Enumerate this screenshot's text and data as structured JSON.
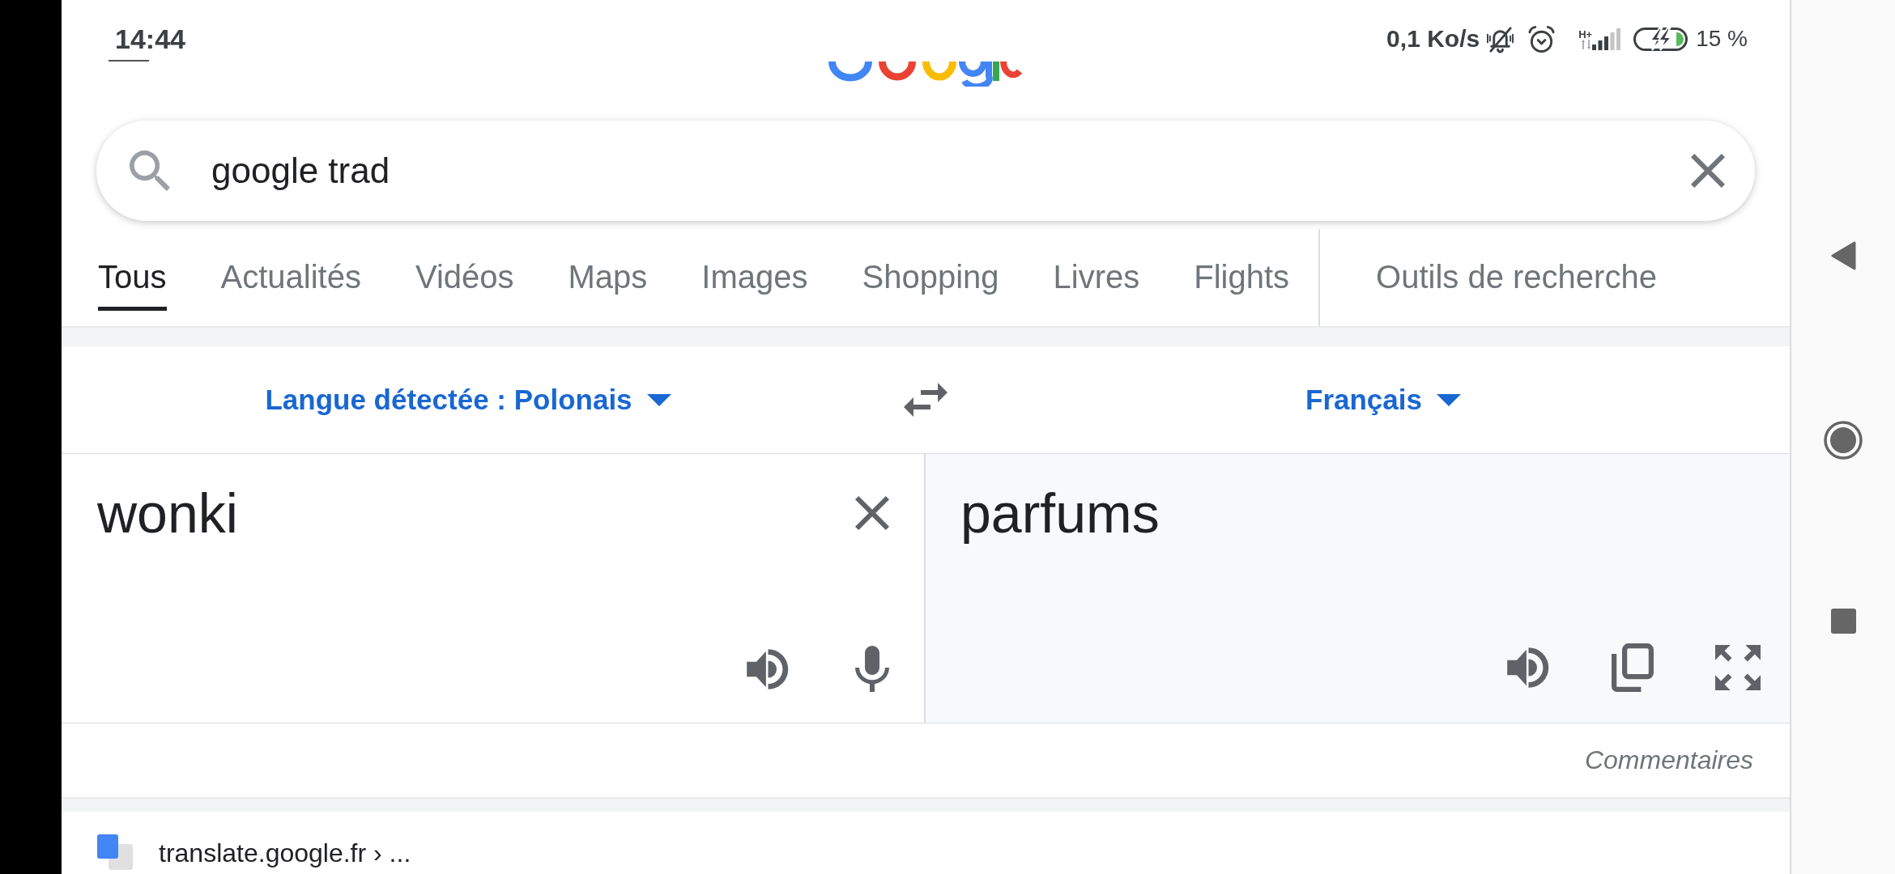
{
  "status_bar": {
    "time": "14:44",
    "network_speed": "0,1 Ko/s",
    "network_type": "H+",
    "battery": "15 %"
  },
  "search": {
    "value": "google trad"
  },
  "tabs": [
    {
      "label": "Tous",
      "selected": true
    },
    {
      "label": "Actualités",
      "selected": false
    },
    {
      "label": "Vidéos",
      "selected": false
    },
    {
      "label": "Maps",
      "selected": false
    },
    {
      "label": "Images",
      "selected": false
    },
    {
      "label": "Shopping",
      "selected": false
    },
    {
      "label": "Livres",
      "selected": false
    },
    {
      "label": "Flights",
      "selected": false
    }
  ],
  "search_tools": {
    "label": "Outils de recherche"
  },
  "translator": {
    "source_language": "Langue détectée : Polonais",
    "target_language": "Français",
    "source_text": "wonki",
    "translation": "parfums",
    "feedback": "Commentaires"
  },
  "result": {
    "url": "translate.google.fr › ..."
  }
}
